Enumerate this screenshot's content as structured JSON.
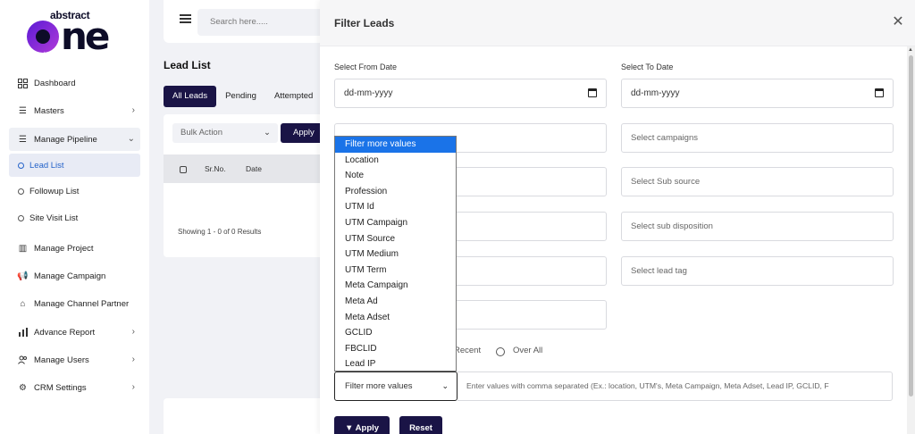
{
  "brand": {
    "small": "abstract",
    "big": "one"
  },
  "sidebar": {
    "items": [
      {
        "label": "Dashboard",
        "icon": "dashboard-icon",
        "chevron": false
      },
      {
        "label": "Masters",
        "icon": "list-icon",
        "chevron": true
      },
      {
        "label": "Manage Pipeline",
        "icon": "list-icon",
        "chevron": true,
        "expanded": true
      },
      {
        "label": "Manage Project",
        "icon": "building-icon",
        "chevron": false
      },
      {
        "label": "Manage Campaign",
        "icon": "megaphone-icon",
        "chevron": false
      },
      {
        "label": "Manage Channel Partner",
        "icon": "handshake-icon",
        "chevron": false
      },
      {
        "label": "Advance Report",
        "icon": "bar-chart-icon",
        "chevron": true
      },
      {
        "label": "Manage Users",
        "icon": "users-icon",
        "chevron": true
      },
      {
        "label": "CRM Settings",
        "icon": "gear-icon",
        "chevron": true
      }
    ],
    "sub_items": [
      {
        "label": "Lead List",
        "active": true
      },
      {
        "label": "Followup List",
        "active": false
      },
      {
        "label": "Site Visit List",
        "active": false
      }
    ]
  },
  "topbar": {
    "search_placeholder": "Search here....."
  },
  "main": {
    "title": "Lead List",
    "tabs": [
      "All Leads",
      "Pending",
      "Attempted"
    ],
    "bulk_action": "Bulk Action",
    "apply": "Apply",
    "columns": [
      "Sr.No.",
      "Date"
    ],
    "showing": "Showing 1 - 0 of 0 Results"
  },
  "panel": {
    "title": "Filter Leads",
    "from_date_label": "Select From Date",
    "to_date_label": "Select To Date",
    "from_date_value": "dd-mm-yyyy",
    "to_date_value": "dd-mm-yyyy",
    "right_fields": [
      "Select campaigns",
      "Select Sub source",
      "Select sub disposition",
      "Select lead tag"
    ],
    "radio_options": [
      "Recent",
      "Over All"
    ],
    "filter_select_value": "Filter more values",
    "values_placeholder": "Enter values with comma separated (Ex.: location, UTM's, Meta Campaign, Meta Adset, Lead IP, GCLID, F",
    "apply_btn": "Apply",
    "reset_btn": "Reset"
  },
  "dropdown": {
    "options": [
      "Filter more values",
      "Location",
      "Note",
      "Profession",
      "UTM Id",
      "UTM Campaign",
      "UTM Source",
      "UTM Medium",
      "UTM Term",
      "Meta Campaign",
      "Meta Ad",
      "Meta Adset",
      "GCLID",
      "FBCLID",
      "Lead IP"
    ],
    "highlighted_index": 0
  },
  "colors": {
    "primary": "#1a1446",
    "highlight": "#1a73e8",
    "active_link": "#2563c9"
  }
}
